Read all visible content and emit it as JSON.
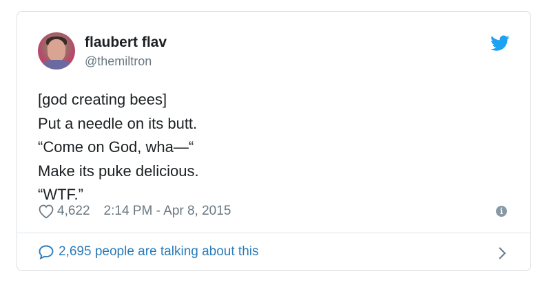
{
  "author": {
    "display_name": "flaubert flav",
    "handle": "@themiltron"
  },
  "tweet": {
    "lines": [
      "[god creating bees]",
      "Put a needle on its butt.",
      "“Come on God, wha—“",
      "Make its puke delicious.",
      "“WTF.”"
    ],
    "likes": "4,622",
    "timestamp": "2:14 PM - Apr 8, 2015"
  },
  "footer": {
    "talking_label": "2,695 people are talking about this"
  },
  "icons": {
    "brand": "twitter-bird-icon",
    "like": "heart-icon",
    "info": "info-icon",
    "reply": "speech-bubble-icon",
    "more": "chevron-right-icon"
  },
  "colors": {
    "brand_blue": "#1da1f2",
    "link_blue": "#2b7bb9",
    "text": "#1c2022",
    "muted": "#697882"
  }
}
